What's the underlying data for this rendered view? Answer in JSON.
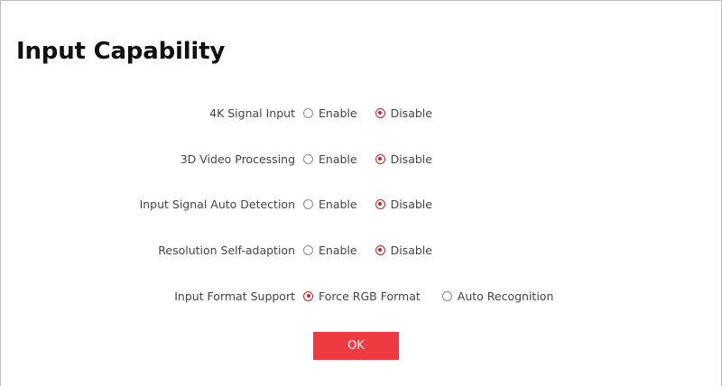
{
  "page": {
    "title": "Input Capability"
  },
  "settings": [
    {
      "label": "4K Signal Input",
      "options": [
        "Enable",
        "Disable"
      ],
      "selected": "Disable"
    },
    {
      "label": "3D Video Processing",
      "options": [
        "Enable",
        "Disable"
      ],
      "selected": "Disable"
    },
    {
      "label": "Input Signal Auto Detection",
      "options": [
        "Enable",
        "Disable"
      ],
      "selected": "Disable"
    },
    {
      "label": "Resolution Self-adaption",
      "options": [
        "Enable",
        "Disable"
      ],
      "selected": "Disable"
    },
    {
      "label": "Input Format Support",
      "options": [
        "Force RGB Format",
        "Auto Recognition"
      ],
      "selected": "Force RGB Format"
    }
  ],
  "actions": {
    "ok_label": "OK"
  },
  "colors": {
    "accent": "#ee3a40",
    "radio_checked": "#c7262c"
  }
}
